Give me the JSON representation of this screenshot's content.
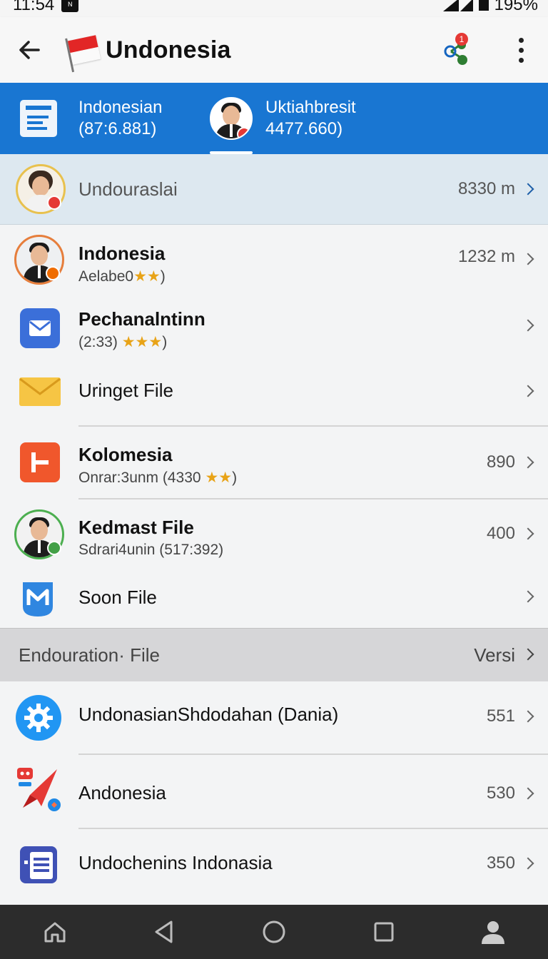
{
  "status_bar": {
    "time": "11:54",
    "battery": "195%"
  },
  "app_bar": {
    "title": "Undonesia"
  },
  "tabs": [
    {
      "title": "Indonesian",
      "subtitle": "(87:6.881)"
    },
    {
      "title": "Uktiahbresit",
      "subtitle": "4477.660)"
    }
  ],
  "highlight_row": {
    "title": "Undouraslai",
    "value": "8330 m"
  },
  "list": [
    {
      "title": "Indonesia",
      "subtitle": "Aelabe0",
      "stars": "★★",
      "sub_close": ")",
      "value": "1232 m"
    },
    {
      "title": "Pechanalntinn",
      "subtitle": "(2:33)",
      "stars": "★★★",
      "sub_close": ")",
      "value": ""
    },
    {
      "title": "Uringet File",
      "subtitle": "",
      "value": ""
    },
    {
      "title": "Kolomesia",
      "subtitle": "Onrar:3unm (4330",
      "stars": "★★",
      "sub_close": ")",
      "value": "890"
    },
    {
      "title": "Kedmast File",
      "subtitle": "Sdrari4unin (517:392)",
      "value": "400"
    },
    {
      "title": "Soon File",
      "subtitle": "",
      "value": ""
    }
  ],
  "section": {
    "title": "Endouration· File",
    "action": "Versi"
  },
  "section_list": [
    {
      "title": "UndonasianShdodahan (Dania)",
      "value": "551"
    },
    {
      "title": "Andonesia",
      "value": "530"
    },
    {
      "title": "Undochenins Indonasia",
      "value": "350"
    }
  ],
  "icons": {
    "back": "arrow-left-icon",
    "share": "share-icon",
    "more": "more-vertical-icon",
    "nav": [
      "home-icon",
      "back-triangle-icon",
      "home-circle-icon",
      "recents-square-icon",
      "profile-icon"
    ]
  },
  "colors": {
    "primary": "#1976d2",
    "highlight": "#dde8f0",
    "section": "#d6d6d8",
    "navbar": "#2c2c2c"
  },
  "share_badge_count": "1"
}
